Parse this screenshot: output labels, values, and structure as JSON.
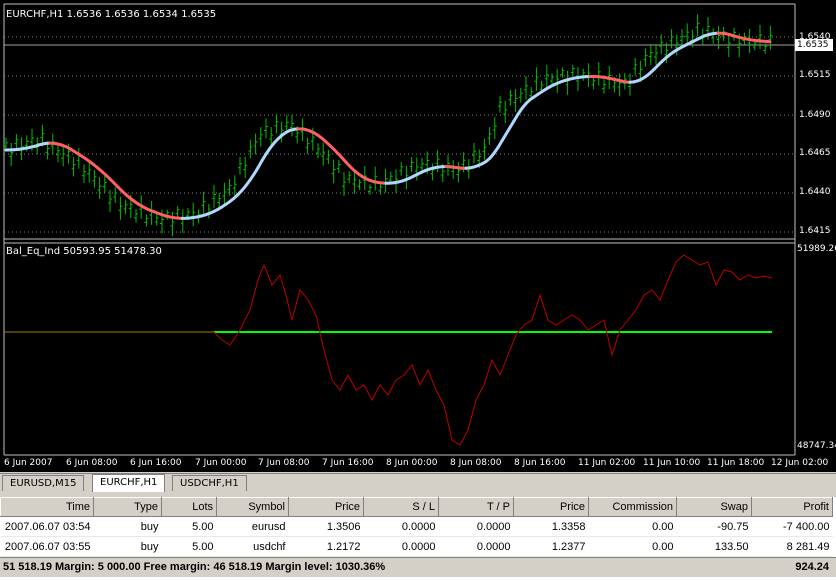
{
  "main_chart": {
    "title": "EURCHF,H1  1.6536 1.6536 1.6534 1.6535",
    "price_labels": [
      "1.6540",
      "1.6515",
      "1.6490",
      "1.6465",
      "1.6440",
      "1.6415"
    ],
    "current_price": "1.6535",
    "colors": {
      "bull_bar": "#00c000",
      "ma_down": "#ff6060",
      "ma_up": "#b0d8ff",
      "grid": "#808080"
    }
  },
  "indicator": {
    "title": "Bal_Eq_Ind 50593.95 51478.30",
    "max_label": "51989.26",
    "min_label": "48747.34",
    "colors": {
      "equity": "#c00000",
      "balance": "#00ff00",
      "balance_before": "#a08000"
    }
  },
  "time_axis": [
    "6 Jun 2007",
    "6 Jun 08:00",
    "6 Jun 16:00",
    "7 Jun 00:00",
    "7 Jun 08:00",
    "7 Jun 16:00",
    "8 Jun 00:00",
    "8 Jun 08:00",
    "8 Jun 16:00",
    "11 Jun 02:00",
    "11 Jun 10:00",
    "11 Jun 18:00",
    "12 Jun 02:00"
  ],
  "tabs": [
    {
      "label": "EURUSD,M15",
      "active": false
    },
    {
      "label": "EURCHF,H1",
      "active": true
    },
    {
      "label": "USDCHF,H1",
      "active": false
    }
  ],
  "terminal": {
    "columns": [
      "Time",
      "Type",
      "Lots",
      "Symbol",
      "Price",
      "S / L",
      "T / P",
      "Price",
      "Commission",
      "Swap",
      "Profit"
    ],
    "rows": [
      [
        "2007.06.07 03:54",
        "buy",
        "5.00",
        "eurusd",
        "1.3506",
        "0.0000",
        "0.0000",
        "1.3358",
        "0.00",
        "-90.75",
        "-7 400.00"
      ],
      [
        "2007.06.07 03:55",
        "buy",
        "5.00",
        "usdchf",
        "1.2172",
        "0.0000",
        "0.0000",
        "1.2377",
        "0.00",
        "133.50",
        "8 281.49"
      ]
    ],
    "summary": "51 518.19  Margin: 5 000.00  Free margin: 46 518.19  Margin level: 1030.36%",
    "total_profit": "924.24"
  }
}
